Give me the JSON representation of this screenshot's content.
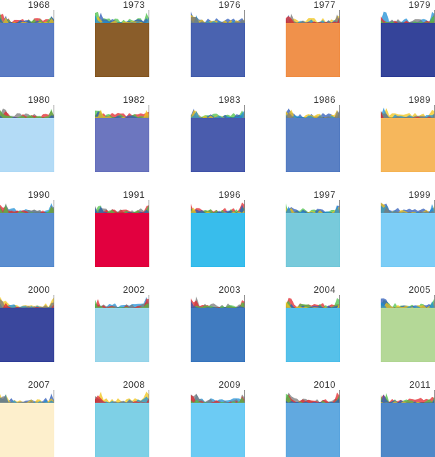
{
  "tiles": [
    {
      "year": "1968",
      "color": "#5b7cc4"
    },
    {
      "year": "1973",
      "color": "#8a5d2a"
    },
    {
      "year": "1976",
      "color": "#4a63b0"
    },
    {
      "year": "1977",
      "color": "#f0914b"
    },
    {
      "year": "1979",
      "color": "#35449a"
    },
    {
      "year": "1980",
      "color": "#b3dbf6"
    },
    {
      "year": "1982",
      "color": "#6c76bf"
    },
    {
      "year": "1983",
      "color": "#4a5cad"
    },
    {
      "year": "1986",
      "color": "#5a80c4"
    },
    {
      "year": "1989",
      "color": "#f6b75c"
    },
    {
      "year": "1990",
      "color": "#5b8ed0"
    },
    {
      "year": "1991",
      "color": "#e2003f"
    },
    {
      "year": "1996",
      "color": "#38bdec"
    },
    {
      "year": "1997",
      "color": "#78cadb"
    },
    {
      "year": "1999",
      "color": "#7ccdf6"
    },
    {
      "year": "2000",
      "color": "#3a479d"
    },
    {
      "year": "2002",
      "color": "#9ad6ea"
    },
    {
      "year": "2003",
      "color": "#407bc0"
    },
    {
      "year": "2004",
      "color": "#56c1ea"
    },
    {
      "year": "2005",
      "color": "#b4d897"
    },
    {
      "year": "2007",
      "color": "#fdefcc"
    },
    {
      "year": "2008",
      "color": "#7ed0e6"
    },
    {
      "year": "2009",
      "color": "#6ccbf4"
    },
    {
      "year": "2010",
      "color": "#61a9e0"
    },
    {
      "year": "2011",
      "color": "#4f88c8"
    }
  ]
}
